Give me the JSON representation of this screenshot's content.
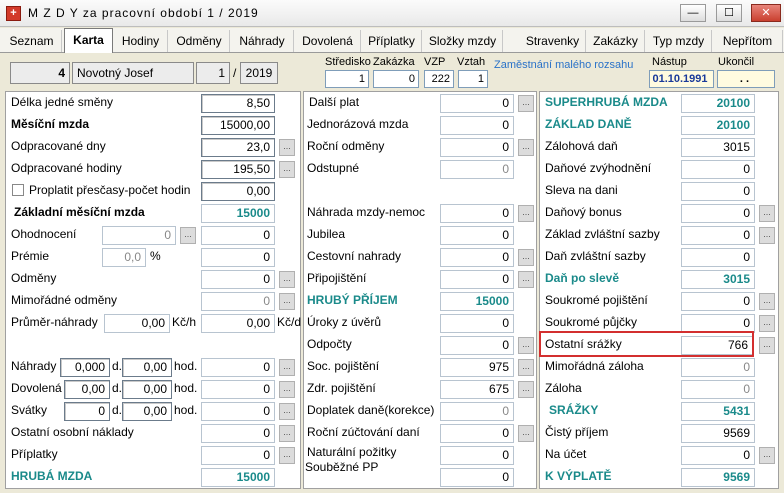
{
  "window": {
    "title": "M Z D Y  za pracovní období  1 / 2019",
    "icon": "app-plus-icon",
    "buttons": [
      "—",
      "☐",
      "✕"
    ]
  },
  "tabs": [
    "Seznam",
    "Karta",
    "Hodiny",
    "Odměny",
    "Náhrady",
    "Dovolená",
    "Příplatky",
    "Složky mzdy",
    "Stravenky",
    "Zakázky",
    "Typ mzdy",
    "Nepřítom"
  ],
  "header": {
    "num": "4",
    "name": "Novotný Josef",
    "month": "1",
    "sep": "/",
    "year": "2019",
    "stredisko_label": "Středisko",
    "stredisko": "1",
    "zakazka_label": "Zakázka",
    "zakazka": "0",
    "vzp_label": "VZP",
    "vzp": "222",
    "vztah_label": "Vztah",
    "vztah": "1",
    "note": "Zaměstnání malého rozsahu",
    "nastup_label": "Nástup",
    "nastup": "01.10.1991",
    "ukonceni_label": "Ukončil",
    "ukonceni": ". ."
  },
  "col1": {
    "delka_label": "Délka jedné směny",
    "delka": "8,50",
    "mesicni_label": "Měsíční mzda",
    "mesicni": "15000,00",
    "odprac_dny_label": "Odpracované dny",
    "odprac_dny": "23,0",
    "odprac_hod_label": "Odpracované hodiny",
    "odprac_hod": "195,50",
    "prescasy_label": "Proplatit přesčasy-počet hodin",
    "prescasy": "0,00",
    "zakladni_label": "Základní měsíční mzda",
    "zakladni": "15000",
    "ohodnoceni_label": "Ohodnocení",
    "ohodnoceni_in": "0",
    "ohodnoceni": "0",
    "premie_label": "Prémie",
    "premie_in": "0,0",
    "premie_pct": "%",
    "premie": "0",
    "odmeny_label": "Odměny",
    "odmeny": "0",
    "mimo_label": "Mimořádné odměny",
    "mimo": "0",
    "prumer_label": "Průměr-náhrady",
    "prumer_a": "0,00",
    "prumer_unit_a": "Kč/h",
    "prumer_b": "0,00",
    "prumer_unit_b": "Kč/d",
    "nahrady_label": "Náhrady",
    "nahrady_d": "0,000",
    "nahrady_h": "0,00",
    "nahrady": "0",
    "dovolena_label": "Dovolená",
    "dovolena_d": "0,00",
    "dovolena_h": "0,00",
    "dovolena": "0",
    "svatky_label": "Svátky",
    "svatky_d": "0",
    "svatky_h": "0,00",
    "svatky": "0",
    "unit_d": "d.",
    "unit_hod": "hod.",
    "ostatni_label": "Ostatní osobní náklady",
    "ostatni": "0",
    "priplatky_label": "Příplatky",
    "priplatky": "0",
    "hruba_label": "HRUBÁ MZDA",
    "hruba": "15000"
  },
  "col2": {
    "dalsi_label": "Další plat",
    "dalsi": "0",
    "jednoraz_label": "Jednorázová mzda",
    "jednoraz": "0",
    "rocni_label": "Roční odměny",
    "rocni": "0",
    "odstupne_label": "Odstupné",
    "odstupne": "0",
    "nahrada_nemoc_label": "Náhrada mzdy-nemoc",
    "nahrada_nemoc": "0",
    "jubilea_label": "Jubilea",
    "jubilea": "0",
    "cestovni_label": "Cestovní nahrady",
    "cestovni": "0",
    "pripojisteni_label": "Připojištění",
    "pripojisteni": "0",
    "hruby_label": "HRUBÝ PŘÍJEM",
    "hruby": "15000",
    "uroky_label": "Úroky z úvěrů",
    "uroky": "0",
    "odpocty_label": "Odpočty",
    "odpocty": "0",
    "soc_label": "Soc. pojištění",
    "soc": "975",
    "zdr_label": "Zdr. pojištění",
    "zdr": "675",
    "doplatek_label": "Doplatek daně(korekce)",
    "doplatek": "0",
    "rocni_zuct_label": "Roční zúčtování daní",
    "rocni_zuct": "0",
    "natural_label": "Naturální požitky",
    "natural": "0",
    "soubezne_label": "Souběžné PP",
    "soubezne": "0"
  },
  "col3": {
    "superhruba_label": "SUPERHRUBÁ MZDA",
    "superhruba": "20100",
    "zaklad_label": "ZÁKLAD DANĚ",
    "zaklad": "20100",
    "zalohova_label": "Zálohová daň",
    "zalohova": "3015",
    "danove_label": "Daňové zvýhodnění",
    "danove": "0",
    "sleva_label": "Sleva na dani",
    "sleva": "0",
    "bonus_label": "Daňový bonus",
    "bonus": "0",
    "zaklad_zvl_label": "Základ zvláštní sazby",
    "zaklad_zvl": "0",
    "dan_zvl_label": "Daň zvláštní sazby",
    "dan_zvl": "0",
    "po_sleve_label": "Daň po slevě",
    "po_sleve": "3015",
    "soukr_poj_label": "Soukromé pojištění",
    "soukr_poj": "0",
    "soukr_puj_label": "Soukromé půjčky",
    "soukr_puj": "0",
    "ostatni_srazky_label": "Ostatní srážky",
    "ostatni_srazky": "766",
    "mimo_zal_label": "Mimořádná záloha",
    "mimo_zal": "0",
    "zaloha_label": "Záloha",
    "zaloha": "0",
    "srazky_label": "SRÁŽKY",
    "srazky": "5431",
    "cisty_label": "Čistý příjem",
    "cisty": "9569",
    "na_ucet_label": "Na účet",
    "na_ucet": "0",
    "k_vyplate_label": "K VÝPLATĚ",
    "k_vyplate": "9569"
  },
  "dots": "..."
}
